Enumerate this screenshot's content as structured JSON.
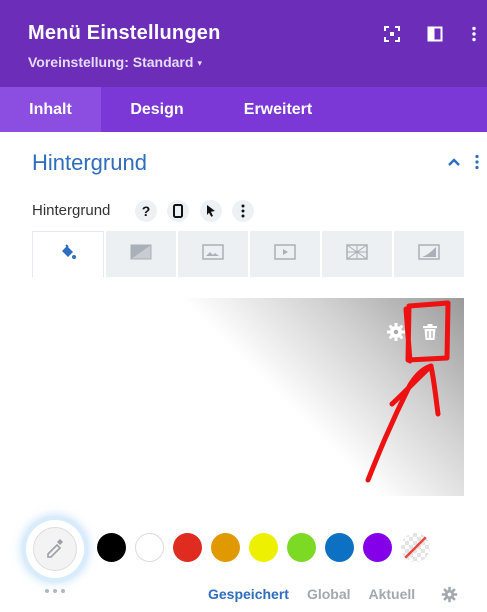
{
  "header": {
    "title": "Menü Einstellungen",
    "preset_label": "Voreinstellung: Standard",
    "caret": "▾",
    "bg_color": "#6c2eb9"
  },
  "tabs": [
    {
      "label": "Inhalt",
      "active": true
    },
    {
      "label": "Design",
      "active": false
    },
    {
      "label": "Erweitert",
      "active": false
    }
  ],
  "section": {
    "title": "Hintergrund",
    "field_label": "Hintergrund",
    "help_glyph": "?"
  },
  "background_tabs": [
    "paint-bucket-icon",
    "gradient-icon",
    "image-icon",
    "video-icon",
    "pattern-icon",
    "mask-icon"
  ],
  "swatches": [
    "#000000",
    "#ffffff",
    "#e02b20",
    "#e09900",
    "#edf000",
    "#7cda24",
    "#0c71c3",
    "#8300e9",
    "none"
  ],
  "footer": {
    "saved": "Gespeichert",
    "global": "Global",
    "current": "Aktuell"
  },
  "colors": {
    "accent": "#2f6dbf",
    "tab_bar": "#7b38d6",
    "annotation": "#ee1111"
  }
}
